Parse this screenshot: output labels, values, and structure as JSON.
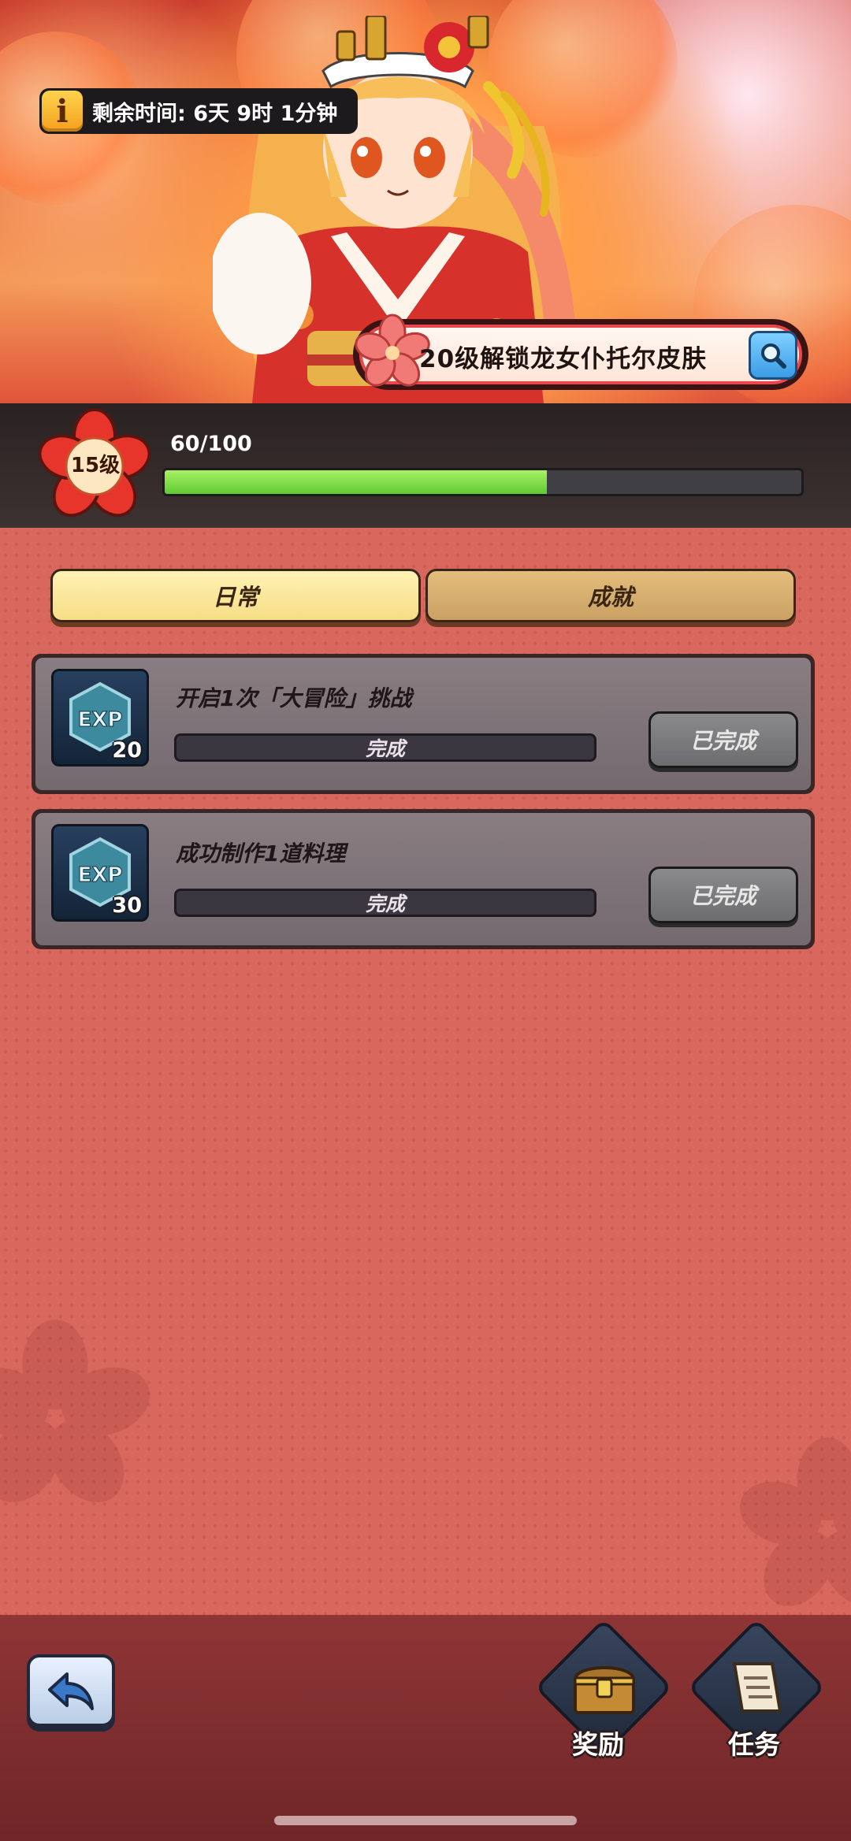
{
  "banner": {
    "timer_text": "剩余时间: 6天 9时 1分钟",
    "timer_icon": "info-icon",
    "unlock_text": "20级解锁龙女仆托尔皮肤",
    "unlock_icon": "magnifier-icon"
  },
  "level": {
    "badge_text": "15级",
    "exp_text": "60/100",
    "exp_fraction": 0.6
  },
  "tabs": [
    {
      "label": "日常",
      "active": true
    },
    {
      "label": "成就",
      "active": false
    }
  ],
  "tasks": [
    {
      "title": "开启1次「大冒险」挑战",
      "exp_label": "EXP",
      "exp": "20",
      "progress_text": "完成",
      "button": "已完成"
    },
    {
      "title": "成功制作1道料理",
      "exp_label": "EXP",
      "exp": "30",
      "progress_text": "完成",
      "button": "已完成"
    }
  ],
  "nav": {
    "rewards_label": "奖励",
    "tasks_label": "任务"
  },
  "colors": {
    "exp_fill": "#6fd23a",
    "background": "#d8685d"
  }
}
